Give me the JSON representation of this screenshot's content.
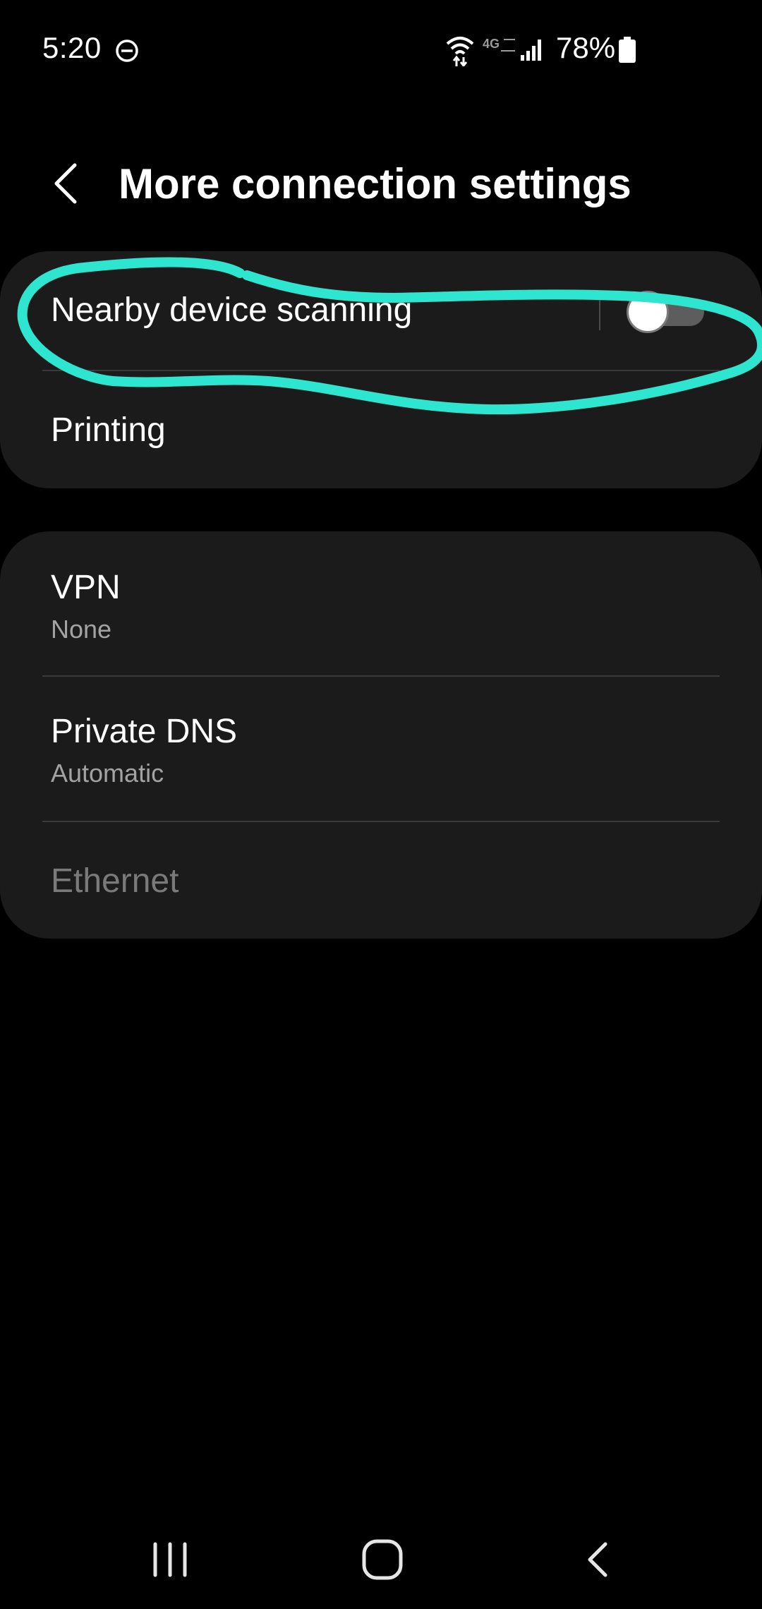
{
  "status_bar": {
    "time": "5:20",
    "battery": "78%",
    "icons": [
      "do-not-disturb-icon",
      "wifi-icon",
      "4g-network-icon",
      "signal-icon",
      "battery-icon"
    ]
  },
  "header": {
    "title": "More connection settings",
    "back_icon": "chevron-left-icon"
  },
  "card_1": {
    "nearby_scanning": {
      "label": "Nearby device scanning",
      "toggle_on": false
    },
    "printing": {
      "label": "Printing"
    }
  },
  "card_2": {
    "vpn": {
      "label": "VPN",
      "value": "None"
    },
    "private_dns": {
      "label": "Private DNS",
      "value": "Automatic"
    },
    "ethernet": {
      "label": "Ethernet",
      "disabled": true
    }
  },
  "annotation": {
    "color": "#2ee5cf",
    "target": "Nearby device scanning"
  },
  "nav_bar": {
    "icons": [
      "recent-apps-icon",
      "home-icon",
      "back-icon"
    ]
  },
  "colors": {
    "background": "#000000",
    "card": "#1b1b1b",
    "divider": "#3a3a3a",
    "secondary_text": "#a3a3a3",
    "disabled_text": "#7a7a7a"
  }
}
